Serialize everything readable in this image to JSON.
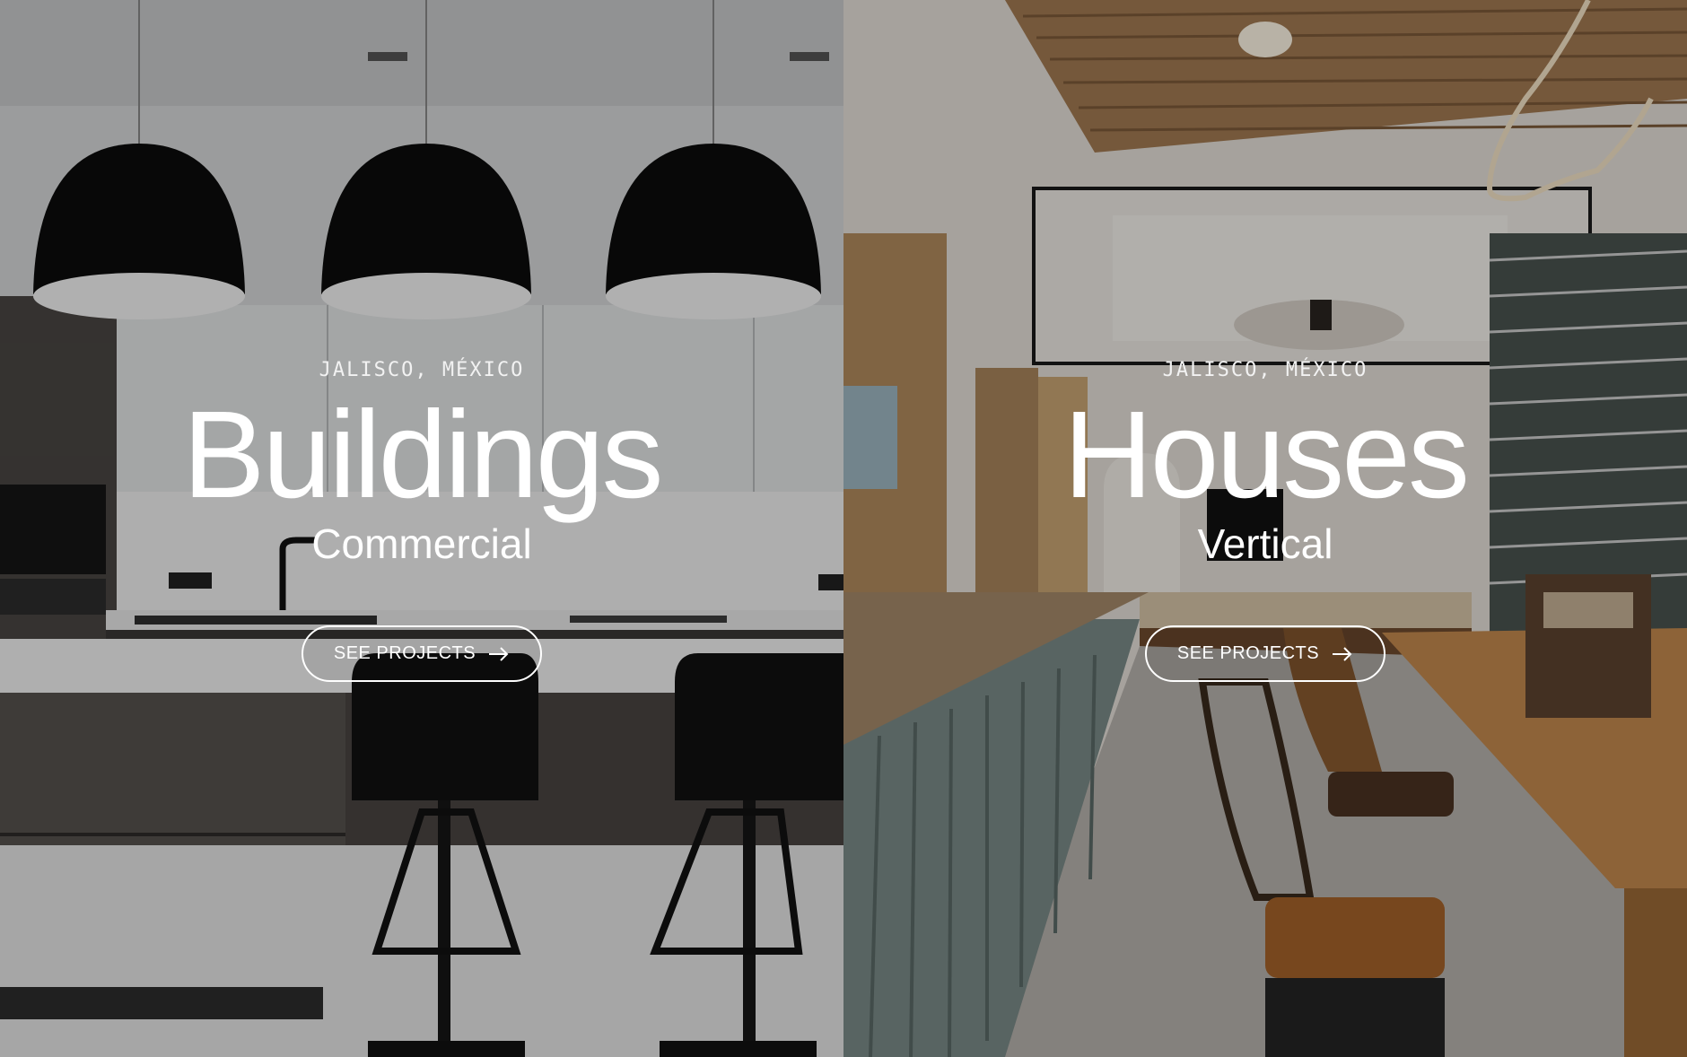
{
  "panels": [
    {
      "location": "JALISCO, MÉXICO",
      "title": "Buildings",
      "subtitle": "Commercial",
      "cta_label": "SEE PROJECTS",
      "cta_icon": "arrow-right-icon",
      "scene": "kitchen-with-black-pendant-lamps"
    },
    {
      "location": "JALISCO, MÉXICO",
      "title": "Houses",
      "subtitle": "Vertical",
      "cta_label": "SEE PROJECTS",
      "cta_icon": "arrow-right-icon",
      "scene": "open-living-dining-with-wood-ceiling"
    }
  ],
  "colors": {
    "text": "#ffffff",
    "overlay": "rgba(0,0,0,0.28)"
  }
}
